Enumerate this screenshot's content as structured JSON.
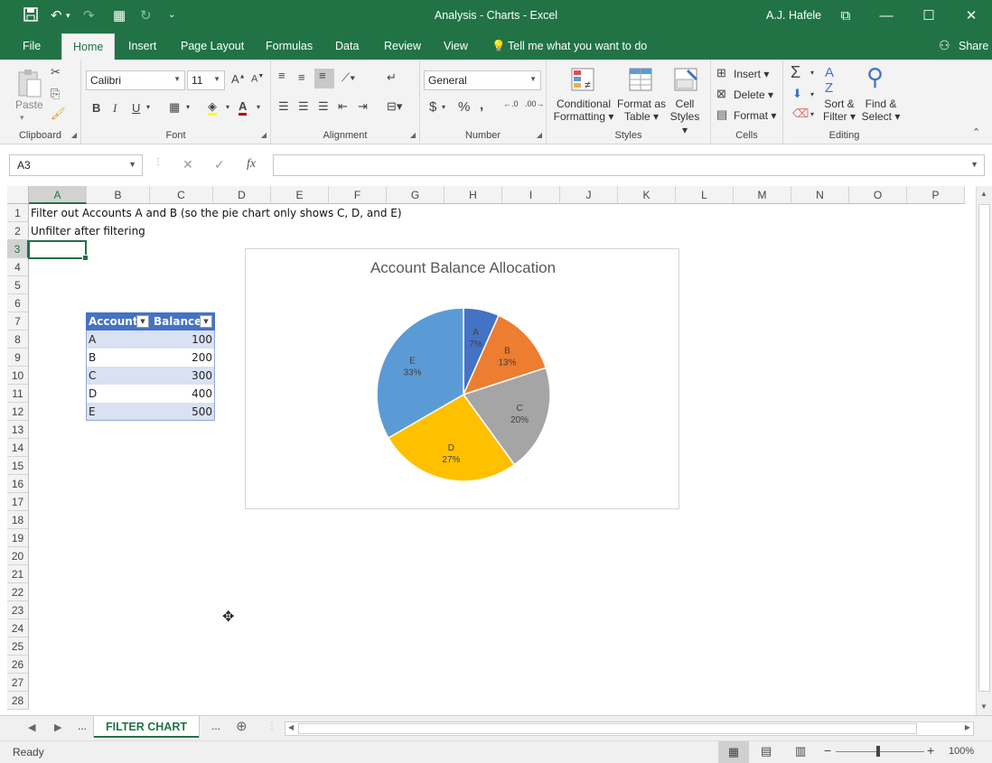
{
  "window": {
    "title": "Analysis - Charts  -  Excel",
    "user": "A.J. Hafele"
  },
  "tabs": [
    "File",
    "Home",
    "Insert",
    "Page Layout",
    "Formulas",
    "Data",
    "Review",
    "View"
  ],
  "tell_me": "Tell me what you want to do",
  "share": "Share",
  "ribbon": {
    "clipboard": {
      "label": "Clipboard",
      "paste": "Paste"
    },
    "font": {
      "label": "Font",
      "name": "Calibri",
      "size": "11",
      "bold": "B",
      "italic": "I",
      "underline": "U"
    },
    "alignment": {
      "label": "Alignment"
    },
    "number": {
      "label": "Number",
      "format": "General"
    },
    "styles": {
      "label": "Styles",
      "cond1": "Conditional",
      "cond2": "Formatting",
      "table1": "Format as",
      "table2": "Table",
      "cell1": "Cell",
      "cell2": "Styles"
    },
    "cells": {
      "label": "Cells",
      "insert": "Insert",
      "delete": "Delete",
      "format": "Format"
    },
    "editing": {
      "label": "Editing",
      "sort1": "Sort &",
      "sort2": "Filter",
      "find1": "Find &",
      "find2": "Select"
    }
  },
  "formula_bar": {
    "name_box": "A3",
    "formula": ""
  },
  "columns": [
    "A",
    "B",
    "C",
    "D",
    "E",
    "F",
    "G",
    "H",
    "I",
    "J",
    "K",
    "L",
    "M",
    "N",
    "O",
    "P"
  ],
  "rows": [
    "1",
    "2",
    "3",
    "4",
    "5",
    "6",
    "7",
    "8",
    "9",
    "10",
    "11",
    "12",
    "13",
    "14",
    "15",
    "16",
    "17",
    "18",
    "19",
    "20",
    "21",
    "22",
    "23",
    "24",
    "25",
    "26",
    "27",
    "28"
  ],
  "cells": {
    "A1": "Filter out Accounts A and B (so the pie chart only shows C, D, and E)",
    "A2": "Unfilter after filtering"
  },
  "table": {
    "headers": [
      "Account",
      "Balance"
    ],
    "rows": [
      {
        "account": "A",
        "balance": "100"
      },
      {
        "account": "B",
        "balance": "200"
      },
      {
        "account": "C",
        "balance": "300"
      },
      {
        "account": "D",
        "balance": "400"
      },
      {
        "account": "E",
        "balance": "500"
      }
    ]
  },
  "chart_data": {
    "type": "pie",
    "title": "Account Balance Allocation",
    "categories": [
      "A",
      "B",
      "C",
      "D",
      "E"
    ],
    "values": [
      100,
      200,
      300,
      400,
      500
    ],
    "labels": [
      "7%",
      "13%",
      "20%",
      "27%",
      "33%"
    ],
    "colors": [
      "#4472c4",
      "#ed7d31",
      "#a5a5a5",
      "#ffc000",
      "#5b9bd5"
    ]
  },
  "sheet_tabs": {
    "active": "FILTER CHART",
    "more_left": "...",
    "more_right": "..."
  },
  "status": {
    "ready": "Ready",
    "zoom": "100%"
  }
}
